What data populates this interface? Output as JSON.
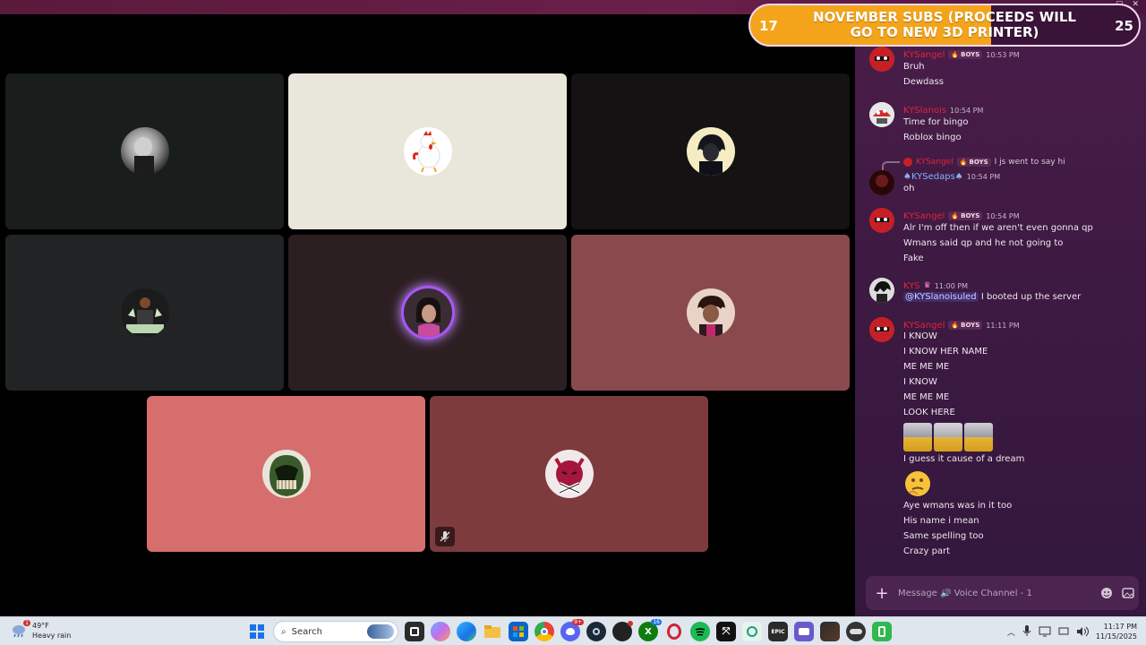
{
  "banner": {
    "title": "NOVEMBER SUBS (PROCEEDS WILL GO TO NEW 3D PRINTER)",
    "left_count": "17",
    "right_count": "25"
  },
  "tag_label": "BOYS",
  "chat": {
    "messages": [
      {
        "username": "KYSangel",
        "has_tag": true,
        "time": "10:53 PM",
        "lines": [
          "Bruh",
          "Dewdass"
        ]
      },
      {
        "username": "KYSlanois",
        "has_tag": false,
        "time": "10:54 PM",
        "lines": [
          "Time for bingo",
          "Roblox bingo"
        ]
      },
      {
        "reply_user": "KYSangel",
        "reply_text": "I js went to say hi",
        "username": "♠KYSedaps♠",
        "time": "10:54 PM",
        "lines": [
          "oh"
        ]
      },
      {
        "username": "KYSangel",
        "has_tag": true,
        "time": "10:54 PM",
        "lines": [
          "Alr I'm off then if we aren't even gonna qp",
          "Wmans said qp and he not going to",
          "Fake"
        ]
      },
      {
        "username": "KYS",
        "has_tag": false,
        "time": "11:00 PM",
        "mention": "@KYSlanoisuled",
        "lines": [
          "I booted up the server"
        ]
      },
      {
        "username": "KYSangel",
        "has_tag": true,
        "time": "11:11 PM",
        "lines": [
          "I KNOW",
          "I KNOW HER NAME",
          "ME ME ME",
          "I KNOW",
          "ME ME ME",
          "LOOK HERE",
          "I guess it cause of a dream",
          "Aye wmans was in it too",
          "His name i mean",
          "Same spelling too",
          "Crazy part"
        ]
      }
    ]
  },
  "composer": {
    "placeholder": "Message 🔊 Voice Channel - 1"
  },
  "taskbar": {
    "temperature": "49°F",
    "weather": "Heavy rain",
    "weather_badge": "1",
    "search_label": "Search",
    "time": "11:17 PM",
    "date": "11/15/2025",
    "discord_badge": "9+",
    "xbox_badge": "16"
  },
  "colors": {
    "tile_dark1": "#191d1c",
    "tile_cream": "#e9e6dc",
    "tile_dark2": "#141212",
    "tile_gray": "#212324",
    "tile_maroon_dark": "#2c1f22",
    "tile_maroon": "#8a4a4d",
    "tile_pink": "#d66e6e",
    "tile_wine": "#7e3b3e",
    "accent_speaking": "#a855f7",
    "banner_orange": "#f3a41b",
    "username_red": "#e0243a"
  }
}
